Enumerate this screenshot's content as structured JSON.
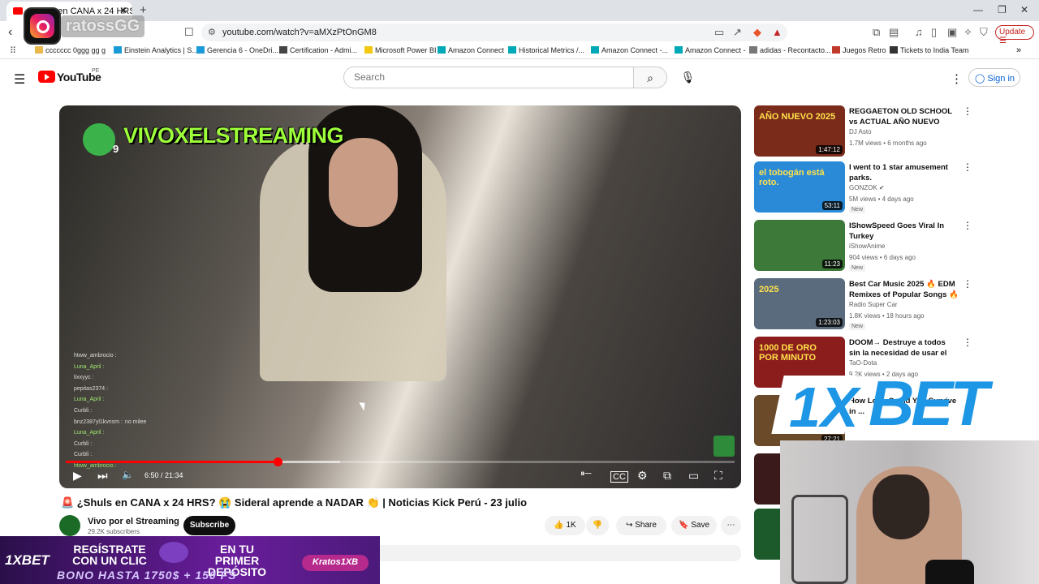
{
  "browser": {
    "tab_title": "¿Shuls en CANA x 24 HRS? 😭",
    "url": "youtube.com/watch?v=aMXzPtOnGM8",
    "update_label": "Update",
    "bookmarks": [
      "ccccccc 0ggg gg g",
      "Einstein Analytics | S...",
      "Gerencia 6 - OneDri...",
      "Certification - Admi...",
      "Microsoft Power BI",
      "Amazon Connect",
      "Historical Metrics /...",
      "Amazon Connect -...",
      "Amazon Connect -",
      "adidas - Recontacto...",
      "Juegos Retro",
      "Tickets to India Team"
    ]
  },
  "overlay": {
    "handle": "ratossGG"
  },
  "youtube": {
    "logo_text": "YouTube",
    "country": "PE",
    "search_placeholder": "Search",
    "signin_label": "Sign in"
  },
  "player": {
    "channel_overlay": "VIVOXELSTREAMING",
    "overlay_number": "9",
    "time": "6:50 / 21:34",
    "progress": 0.317,
    "buffered": 0.41,
    "chat": [
      {
        "user": "htww_ambrocio :",
        "msg": ""
      },
      {
        "user": "Luna_April :",
        "msg": ""
      },
      {
        "user": "lixxyyc :",
        "msg": ""
      },
      {
        "user": "pepitas2374 :",
        "msg": ""
      },
      {
        "user": "Luna_April :",
        "msg": ""
      },
      {
        "user": "Curbli :",
        "msg": ""
      },
      {
        "user": "bnz2387yl1kvnsm :",
        "msg": "no milee"
      },
      {
        "user": "Luna_April :",
        "msg": ""
      },
      {
        "user": "Curbli :",
        "msg": ""
      },
      {
        "user": "Curbli :",
        "msg": ""
      },
      {
        "user": "htww_ambrocio :",
        "msg": ""
      }
    ]
  },
  "video": {
    "title": "🚨 ¿Shuls en CANA x 24 HRS? 😭 Sideral aprende a NADAR 👏 | Noticias Kick Perú - 23 julio",
    "channel": "Vivo por el Streaming",
    "subscribers": "29.2K subscribers",
    "subscribe_label": "Subscribe",
    "likes": "1K",
    "share_label": "Share",
    "save_label": "Save"
  },
  "sidebar": [
    {
      "title": "REGGAETON OLD SCHOOL vs ACTUAL AÑO NUEVO 2025 | ...",
      "channel": "DJ Asto",
      "meta": "1.7M views • 6 months ago",
      "duration": "1:47:12",
      "new": "",
      "thumb_text": "AÑO NUEVO 2025",
      "color": "#7a2b1a"
    },
    {
      "title": "I went to 1 star amusement parks.",
      "channel": "GONZOK ✔",
      "meta": "5M views • 4 days ago",
      "duration": "53:11",
      "new": "New",
      "thumb_text": "el tobogán está roto.",
      "color": "#2a8ad8"
    },
    {
      "title": "IShowSpeed Goes Viral In Turkey",
      "channel": "iShowAnime",
      "meta": "904 views • 6 days ago",
      "duration": "11:23",
      "new": "New",
      "thumb_text": "",
      "color": "#3d7a3a"
    },
    {
      "title": "Best Car Music 2025 🔥 EDM Remixes of Popular Songs 🔥 ...",
      "channel": "Radio Super Car",
      "meta": "1.8K views • 18 hours ago",
      "duration": "1:23:03",
      "new": "New",
      "thumb_text": "2025",
      "color": "#5a6b7e"
    },
    {
      "title": "DOOM→ Destruye a todos sin la necesidad de usar el DOOM co...",
      "channel": "TaO-Dota",
      "meta": "9.2K views • 2 days ago",
      "duration": "52:42",
      "new": "",
      "thumb_text": "1000 DE ORO POR MINUTO",
      "color": "#8c1d1d"
    },
    {
      "title": "How Long Could You Survive in ...",
      "channel": "",
      "meta": "",
      "duration": "27:21",
      "new": "",
      "thumb_text": "",
      "color": "#6b4a2a"
    }
  ],
  "bet_overlay": "BET",
  "ad": {
    "brand": "1XBET",
    "line1a": "REGÍSTRATE CON UN CLIC",
    "line1b": "EN TU PRIMER DEPÓSITO",
    "line2": "BONO HASTA 1750$ + 150 FS",
    "pill": "Kratos1XB"
  }
}
